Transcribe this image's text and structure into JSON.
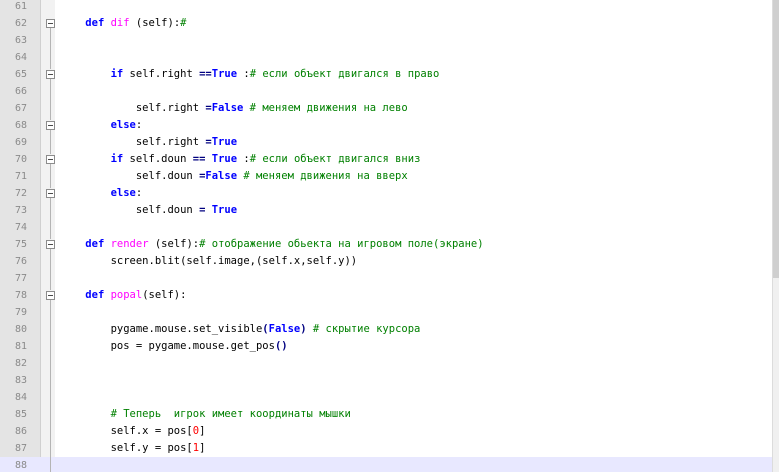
{
  "colors": {
    "keyword": "#0000ff",
    "function_name": "#ff00ff",
    "comment": "#008000",
    "number": "#ff0000",
    "current_line": "#e8e8ff",
    "gutter": "#e4e4e4"
  },
  "lines": [
    {
      "num": "61",
      "fold": false,
      "tokens": []
    },
    {
      "num": "62",
      "fold": true,
      "tokens": [
        {
          "t": "    "
        },
        {
          "t": "def",
          "c": "kw"
        },
        {
          "t": " "
        },
        {
          "t": "dif",
          "c": "fn"
        },
        {
          "t": " (self):"
        },
        {
          "t": "#",
          "c": "cm"
        }
      ]
    },
    {
      "num": "63",
      "fold": false,
      "tokens": []
    },
    {
      "num": "64",
      "fold": false,
      "tokens": []
    },
    {
      "num": "65",
      "fold": true,
      "tokens": [
        {
          "t": "        "
        },
        {
          "t": "if",
          "c": "kw"
        },
        {
          "t": " self.right "
        },
        {
          "t": "==",
          "c": "op"
        },
        {
          "t": "True",
          "c": "kw"
        },
        {
          "t": " :"
        },
        {
          "t": "# если объект двигался в право",
          "c": "cm"
        }
      ]
    },
    {
      "num": "66",
      "fold": false,
      "tokens": []
    },
    {
      "num": "67",
      "fold": false,
      "tokens": [
        {
          "t": "            self.right "
        },
        {
          "t": "=",
          "c": "op"
        },
        {
          "t": "False",
          "c": "kw"
        },
        {
          "t": " "
        },
        {
          "t": "# меняем движения на лево",
          "c": "cm"
        }
      ]
    },
    {
      "num": "68",
      "fold": true,
      "tokens": [
        {
          "t": "        "
        },
        {
          "t": "else",
          "c": "kw"
        },
        {
          "t": ":"
        }
      ]
    },
    {
      "num": "69",
      "fold": false,
      "tokens": [
        {
          "t": "            self.right "
        },
        {
          "t": "=",
          "c": "op"
        },
        {
          "t": "True",
          "c": "kw"
        }
      ]
    },
    {
      "num": "70",
      "fold": true,
      "tokens": [
        {
          "t": "        "
        },
        {
          "t": "if",
          "c": "kw"
        },
        {
          "t": " self.doun "
        },
        {
          "t": "==",
          "c": "op"
        },
        {
          "t": " "
        },
        {
          "t": "True",
          "c": "kw"
        },
        {
          "t": " :"
        },
        {
          "t": "# если объект двигался вниз",
          "c": "cm"
        }
      ]
    },
    {
      "num": "71",
      "fold": false,
      "tokens": [
        {
          "t": "            self.doun "
        },
        {
          "t": "=",
          "c": "op"
        },
        {
          "t": "False",
          "c": "kw"
        },
        {
          "t": " "
        },
        {
          "t": "# меняем движения на вверх",
          "c": "cm"
        }
      ]
    },
    {
      "num": "72",
      "fold": true,
      "tokens": [
        {
          "t": "        "
        },
        {
          "t": "else",
          "c": "kw"
        },
        {
          "t": ":"
        }
      ]
    },
    {
      "num": "73",
      "fold": false,
      "tokens": [
        {
          "t": "            self.doun "
        },
        {
          "t": "=",
          "c": "op"
        },
        {
          "t": " "
        },
        {
          "t": "True",
          "c": "kw"
        }
      ]
    },
    {
      "num": "74",
      "fold": false,
      "tokens": []
    },
    {
      "num": "75",
      "fold": true,
      "tokens": [
        {
          "t": "    "
        },
        {
          "t": "def",
          "c": "kw"
        },
        {
          "t": " "
        },
        {
          "t": "render",
          "c": "fn"
        },
        {
          "t": " (self):"
        },
        {
          "t": "# отображение обьекта на игровом поле(экране)",
          "c": "cm"
        }
      ]
    },
    {
      "num": "76",
      "fold": false,
      "tokens": [
        {
          "t": "        screen.blit(self.image,(self.x,self.y))"
        }
      ]
    },
    {
      "num": "77",
      "fold": false,
      "tokens": []
    },
    {
      "num": "78",
      "fold": true,
      "tokens": [
        {
          "t": "    "
        },
        {
          "t": "def",
          "c": "kw"
        },
        {
          "t": " "
        },
        {
          "t": "popal",
          "c": "fn"
        },
        {
          "t": "(self):"
        }
      ]
    },
    {
      "num": "79",
      "fold": false,
      "tokens": []
    },
    {
      "num": "80",
      "fold": false,
      "tokens": [
        {
          "t": "        pygame.mouse.set_visible"
        },
        {
          "t": "(",
          "c": "op"
        },
        {
          "t": "False",
          "c": "kw"
        },
        {
          "t": ")",
          "c": "op"
        },
        {
          "t": " "
        },
        {
          "t": "# скрытие курсора",
          "c": "cm"
        }
      ]
    },
    {
      "num": "81",
      "fold": false,
      "tokens": [
        {
          "t": "        pos = pygame.mouse.get_pos"
        },
        {
          "t": "()",
          "c": "op"
        }
      ]
    },
    {
      "num": "82",
      "fold": false,
      "tokens": []
    },
    {
      "num": "83",
      "fold": false,
      "tokens": []
    },
    {
      "num": "84",
      "fold": false,
      "tokens": []
    },
    {
      "num": "85",
      "fold": false,
      "tokens": [
        {
          "t": "        "
        },
        {
          "t": "# Теперь  игрок имеет координаты мышки",
          "c": "cm"
        }
      ]
    },
    {
      "num": "86",
      "fold": false,
      "tokens": [
        {
          "t": "        self.x = pos["
        },
        {
          "t": "0",
          "c": "num"
        },
        {
          "t": "]"
        }
      ]
    },
    {
      "num": "87",
      "fold": false,
      "tokens": [
        {
          "t": "        self.y = pos["
        },
        {
          "t": "1",
          "c": "num"
        },
        {
          "t": "]"
        }
      ]
    },
    {
      "num": "88",
      "fold": false,
      "current": true,
      "tokens": []
    }
  ]
}
